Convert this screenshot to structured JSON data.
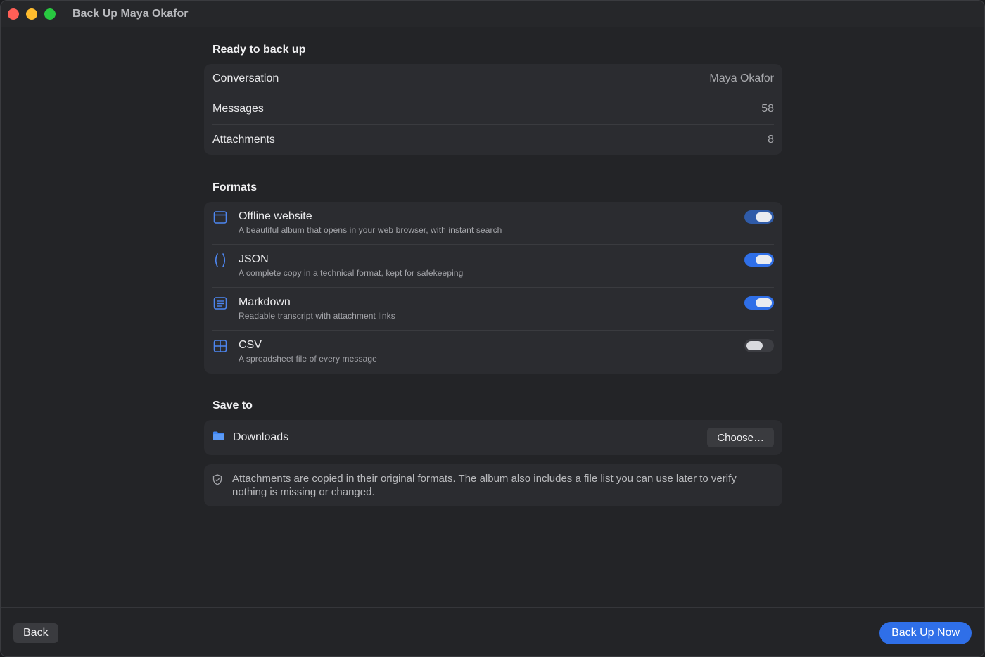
{
  "window": {
    "title": "Back Up Maya Okafor"
  },
  "summary": {
    "heading": "Ready to back up",
    "rows": [
      {
        "label": "Conversation",
        "value": "Maya Okafor"
      },
      {
        "label": "Messages",
        "value": "58"
      },
      {
        "label": "Attachments",
        "value": "8"
      }
    ]
  },
  "formats": {
    "heading": "Formats",
    "items": [
      {
        "name": "Offline website",
        "description": "A beautiful album that opens in your web browser, with instant search",
        "icon": "browser-window-icon",
        "enabled": true
      },
      {
        "name": "JSON",
        "description": "A complete copy in a technical format, kept for safekeeping",
        "icon": "parentheses-icon",
        "enabled": true
      },
      {
        "name": "Markdown",
        "description": "Readable transcript with attachment links",
        "icon": "document-lines-icon",
        "enabled": true
      },
      {
        "name": "CSV",
        "description": "A spreadsheet file of every message",
        "icon": "table-grid-icon",
        "enabled": false
      }
    ]
  },
  "save_to": {
    "heading": "Save to",
    "folder": "Downloads",
    "choose_label": "Choose…"
  },
  "note": {
    "text": "Attachments are copied in their original formats. The album also includes a file list you can use later to verify nothing is missing or changed."
  },
  "footer": {
    "back_label": "Back",
    "primary_label": "Back Up Now"
  },
  "colors": {
    "accent": "#2f6fe8",
    "background": "#232427",
    "card": "#2b2c30"
  }
}
